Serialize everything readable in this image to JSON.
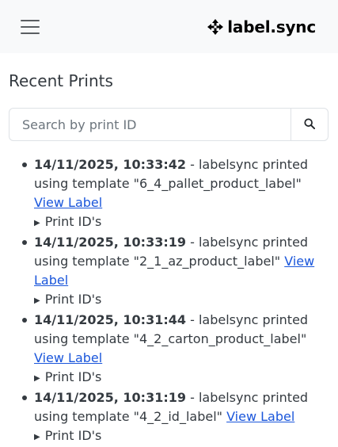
{
  "header": {
    "brand": "label.sync",
    "menu_icon": "hamburger-menu-icon",
    "brand_icon": "move-arrows-icon"
  },
  "main": {
    "title": "Recent Prints",
    "search": {
      "placeholder": "Search by print ID",
      "value": "",
      "button_icon": "search-icon"
    },
    "prints": [
      {
        "time": "14/11/2025, 10:33:42",
        "text": " - labelsync printed using template \"6_4_pallet_product_label\" ",
        "link": "View Label",
        "toggle": "Print ID's"
      },
      {
        "time": "14/11/2025, 10:33:19",
        "text": " - labelsync printed using template \"2_1_az_product_label\" ",
        "link": "View Label",
        "toggle": "Print ID's"
      },
      {
        "time": "14/11/2025, 10:31:44",
        "text": " - labelsync printed using template \"4_2_carton_product_label\" ",
        "link": "View Label",
        "toggle": "Print ID's"
      },
      {
        "time": "14/11/2025, 10:31:19",
        "text": " - labelsync printed using template \"4_2_id_label\" ",
        "link": "View Label",
        "toggle": "Print ID's"
      }
    ]
  },
  "colors": {
    "navbar_bg": "#f8f9fa",
    "link": "#1a56db",
    "text": "#343a40"
  }
}
